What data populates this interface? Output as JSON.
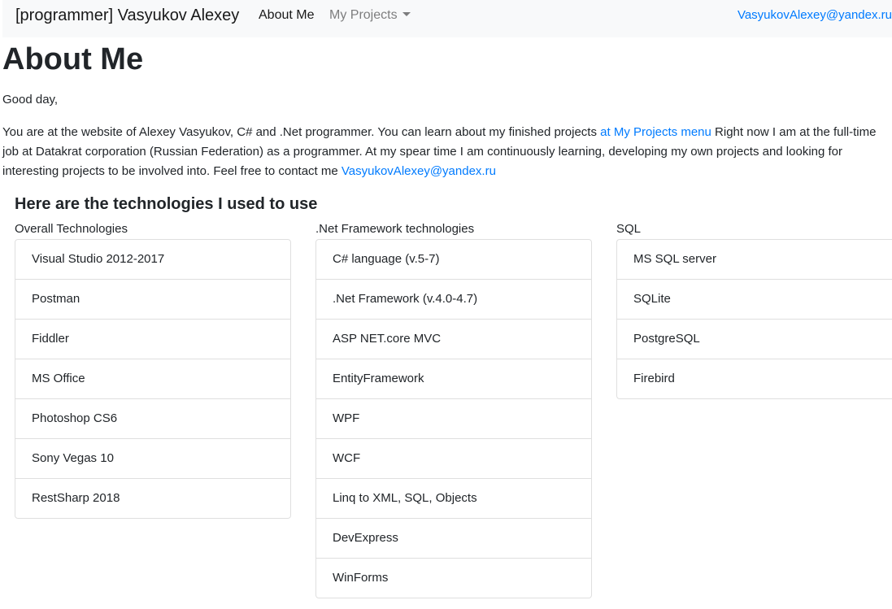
{
  "navbar": {
    "brand": "[programmer] Vasyukov Alexey",
    "about_link": "About Me",
    "projects_link": "My Projects",
    "email": "VasyukovAlexey@yandex.ru"
  },
  "page": {
    "title": "About Me",
    "greeting": "Good day,",
    "intro_part1": "You are at the website of Alexey Vasyukov, C# and .Net programmer. You can learn about my finished projects ",
    "intro_link": "at My Projects menu",
    "intro_part2": " Right now I am at the full-time job at Datakrat corporation (Russian Federation) as a programmer. At my spear time I am continuously learning, developing my own projects and looking for interesting projects to be involved into. Feel free to contact me ",
    "intro_email": "VasyukovAlexey@yandex.ru"
  },
  "technologies": {
    "heading": "Here are the technologies I used to use",
    "columns": [
      {
        "label": "Overall Technologies",
        "items": [
          "Visual Studio 2012-2017",
          "Postman",
          "Fiddler",
          "MS Office",
          "Photoshop CS6",
          "Sony Vegas 10",
          "RestSharp 2018"
        ]
      },
      {
        "label": ".Net Framework technologies",
        "items": [
          "C# language (v.5-7)",
          ".Net Framework (v.4.0-4.7)",
          "ASP NET.core MVC",
          "EntityFramework",
          "WPF",
          "WCF",
          "Linq to XML, SQL, Objects",
          "DevExpress",
          "WinForms"
        ]
      },
      {
        "label": "SQL",
        "items": [
          "MS SQL server",
          "SQLite",
          "PostgreSQL",
          "Firebird"
        ]
      }
    ]
  },
  "colors": {
    "link": "#007bff",
    "navbar_bg": "#f8f9fa"
  }
}
